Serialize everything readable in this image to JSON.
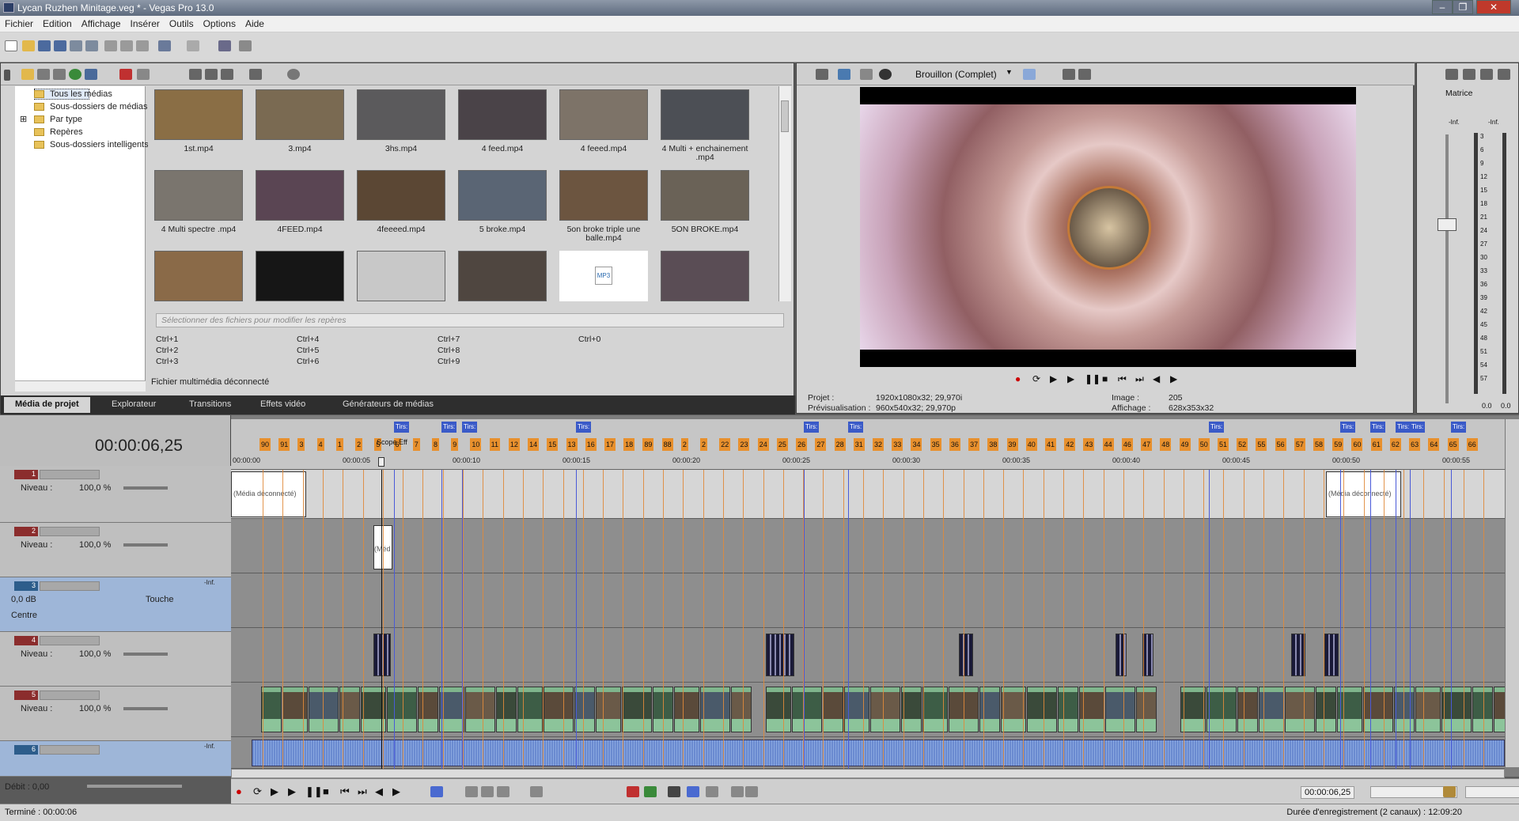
{
  "window": {
    "title": "Lycan Ruzhen Minitage.veg * - Vegas Pro 13.0"
  },
  "menu": [
    "Fichier",
    "Edition",
    "Affichage",
    "Insérer",
    "Outils",
    "Options",
    "Aide"
  ],
  "media_tree": {
    "items": [
      "Tous les médias",
      "Sous-dossiers de médias",
      "Par type",
      "Repères",
      "Sous-dossiers intelligents"
    ]
  },
  "media_grid": {
    "items": [
      {
        "name": "1st.mp4",
        "color": "#8a6e45"
      },
      {
        "name": "3.mp4",
        "color": "#7a6a52"
      },
      {
        "name": "3hs.mp4",
        "color": "#5b5a5c"
      },
      {
        "name": "4 feed.mp4",
        "color": "#4a4348"
      },
      {
        "name": "4 feeed.mp4",
        "color": "#7d7368"
      },
      {
        "name": "4 Multi + enchainement .mp4",
        "color": "#4c4f55"
      },
      {
        "name": "4 Multi spectre .mp4",
        "color": "#7a756e"
      },
      {
        "name": "4FEED.mp4",
        "color": "#5a4553"
      },
      {
        "name": "4feeeed.mp4",
        "color": "#5b4734"
      },
      {
        "name": "5 broke.mp4",
        "color": "#5a6574"
      },
      {
        "name": "5on broke triple une balle.mp4",
        "color": "#6c5540"
      },
      {
        "name": "5ON BROKE.mp4",
        "color": "#6a6257"
      },
      {
        "name": "",
        "color": "#8a6a48"
      },
      {
        "name": "",
        "color": "#161616"
      },
      {
        "name": "",
        "color": "#c8c8c8"
      },
      {
        "name": "",
        "color": "#4f4640"
      },
      {
        "name": "",
        "color": "#ffffff"
      },
      {
        "name": "",
        "color": "#5a4d55"
      }
    ],
    "mp3_label": "MP3"
  },
  "tagbox_placeholder": "Sélectionner des fichiers pour modifier les repères",
  "shortcuts": [
    "Ctrl+1",
    "Ctrl+4",
    "Ctrl+7",
    "Ctrl+0",
    "Ctrl+2",
    "Ctrl+5",
    "Ctrl+8",
    "Ctrl+3",
    "Ctrl+6",
    "Ctrl+9"
  ],
  "offline_text": "Fichier multimédia déconnecté",
  "tabs": [
    "Média de projet",
    "Explorateur",
    "Transitions",
    "Effets vidéo",
    "Générateurs de médias"
  ],
  "preview": {
    "quality": "Brouillon (Complet)",
    "projet_label": "Projet :",
    "projet_val": "1920x1080x32; 29,970i",
    "prev_label": "Prévisualisation :",
    "prev_val": "960x540x32; 29,970p",
    "image_label": "Image :",
    "image_val": "205",
    "aff_label": "Affichage :",
    "aff_val": "628x353x32"
  },
  "master": {
    "label": "Matrice",
    "inf_left": "-Inf.",
    "inf_right": "-Inf.",
    "scale": [
      "3",
      "6",
      "9",
      "12",
      "15",
      "18",
      "21",
      "24",
      "27",
      "30",
      "33",
      "36",
      "39",
      "42",
      "45",
      "48",
      "51",
      "54",
      "57"
    ],
    "bottom_left": "0.0",
    "bottom_right": "0.0"
  },
  "timeline": {
    "timecode": "00:00:06,25",
    "ticks": [
      "00:00:00",
      "00:00:05",
      "00:00:10",
      "00:00:15",
      "00:00:20",
      "00:00:25",
      "00:00:30",
      "00:00:35",
      "00:00:40",
      "00:00:45",
      "00:00:50",
      "00:00:55"
    ],
    "region_label": "Tirs:",
    "region_special": "Scope Eff",
    "markers": [
      "90",
      "91",
      "3",
      "4",
      "1",
      "2",
      "5",
      "6",
      "7",
      "8",
      "9",
      "10",
      "11",
      "12",
      "14",
      "15",
      "13",
      "16",
      "17",
      "18",
      "89",
      "88",
      "2",
      "2",
      "22",
      "23",
      "24",
      "25",
      "26",
      "27",
      "28",
      "31",
      "32",
      "33",
      "34",
      "35",
      "36",
      "37",
      "38",
      "39",
      "40",
      "41",
      "42",
      "43",
      "44",
      "46",
      "47",
      "48",
      "49",
      "50",
      "51",
      "52",
      "55",
      "56",
      "57",
      "58",
      "59",
      "60",
      "61",
      "62",
      "63",
      "64",
      "65",
      "66"
    ],
    "tracks": [
      {
        "num": "1",
        "kind": "video",
        "level_label": "Niveau :",
        "level": "100,0 %"
      },
      {
        "num": "2",
        "kind": "video",
        "level_label": "Niveau :",
        "level": "100,0 %"
      },
      {
        "num": "3",
        "kind": "audio",
        "vol": "0,0 dB",
        "touch": "Touche",
        "pan_label": "Centre",
        "inf": "-Inf."
      },
      {
        "num": "4",
        "kind": "video",
        "level_label": "Niveau :",
        "level": "100,0 %"
      },
      {
        "num": "5",
        "kind": "video",
        "level_label": "Niveau :",
        "level": "100,0 %"
      },
      {
        "num": "6",
        "kind": "audio",
        "inf": "-Inf."
      }
    ],
    "offline_clip": "(Média déconnecté)",
    "short_clip": "(Méd"
  },
  "transport": {
    "rate_label": "Débit : 0,00",
    "timecode": "00:00:06,25",
    "end": "12:09:20"
  },
  "status": {
    "left": "Terminé : 00:00:06",
    "right": "Durée d'enregistrement (2 canaux) : 12:09:20"
  }
}
